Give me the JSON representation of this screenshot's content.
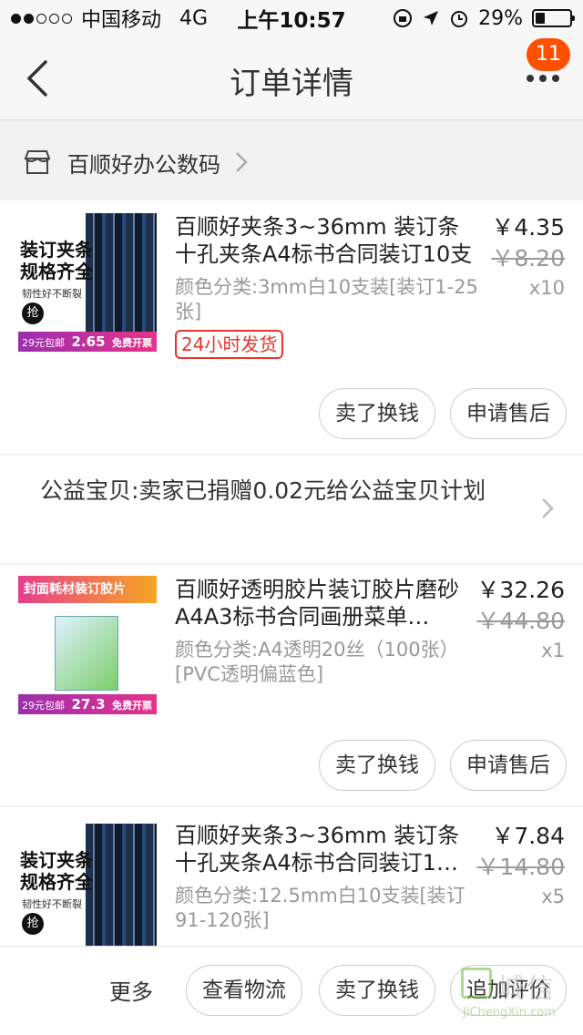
{
  "status_bar": {
    "carrier": "中国移动",
    "network": "4G",
    "time": "上午10:57",
    "battery": "29%",
    "battery_level": 0.29
  },
  "nav": {
    "title": "订单详情",
    "badge": "11"
  },
  "shop": {
    "name": "百顺好办公数码"
  },
  "items": [
    {
      "title": "百顺好夹条3~36mm 装订条十孔夹条A4标书合同装订10支装",
      "spec": "颜色分类:3mm白10支装[装订1-25张]",
      "tag": "24小时发货",
      "price": "￥4.35",
      "old_price": "￥8.20",
      "qty": "x10",
      "buttons": [
        "卖了换钱",
        "申请售后"
      ]
    },
    {
      "title": "百顺好透明胶片装订胶片磨砂A4A3标书合同画册菜单…",
      "spec": "颜色分类:A4透明20丝（100张）[PVC透明偏蓝色]",
      "price": "￥32.26",
      "old_price": "￥44.80",
      "qty": "x1",
      "buttons": [
        "卖了换钱",
        "申请售后"
      ]
    },
    {
      "title": "百顺好夹条3~36mm 装订条十孔夹条A4标书合同装订1…",
      "spec": "颜色分类:12.5mm白10支装[装订91-120张]",
      "price": "￥7.84",
      "old_price": "￥14.80",
      "qty": "x5"
    }
  ],
  "charity": {
    "text": "公益宝贝:卖家已捐赠0.02元给公益宝贝计划"
  },
  "product_images": {
    "binding_strips": {
      "line1": "装订夹条",
      "line2": "规格齐全",
      "line3": "韧性好不断裂",
      "mark": "抢",
      "promo": "29元包邮",
      "price": "2.65",
      "badge": "免费开票"
    },
    "covers": {
      "header": "封面耗材装订胶片",
      "promo": "29元包邮",
      "price": "27.3",
      "badge": "免费开票"
    }
  },
  "bottom_bar": {
    "more": "更多",
    "buttons": [
      "查看物流",
      "卖了换钱",
      "追加评价"
    ]
  },
  "watermark": {
    "cn": "城信",
    "url": "JiChengXin.com"
  }
}
